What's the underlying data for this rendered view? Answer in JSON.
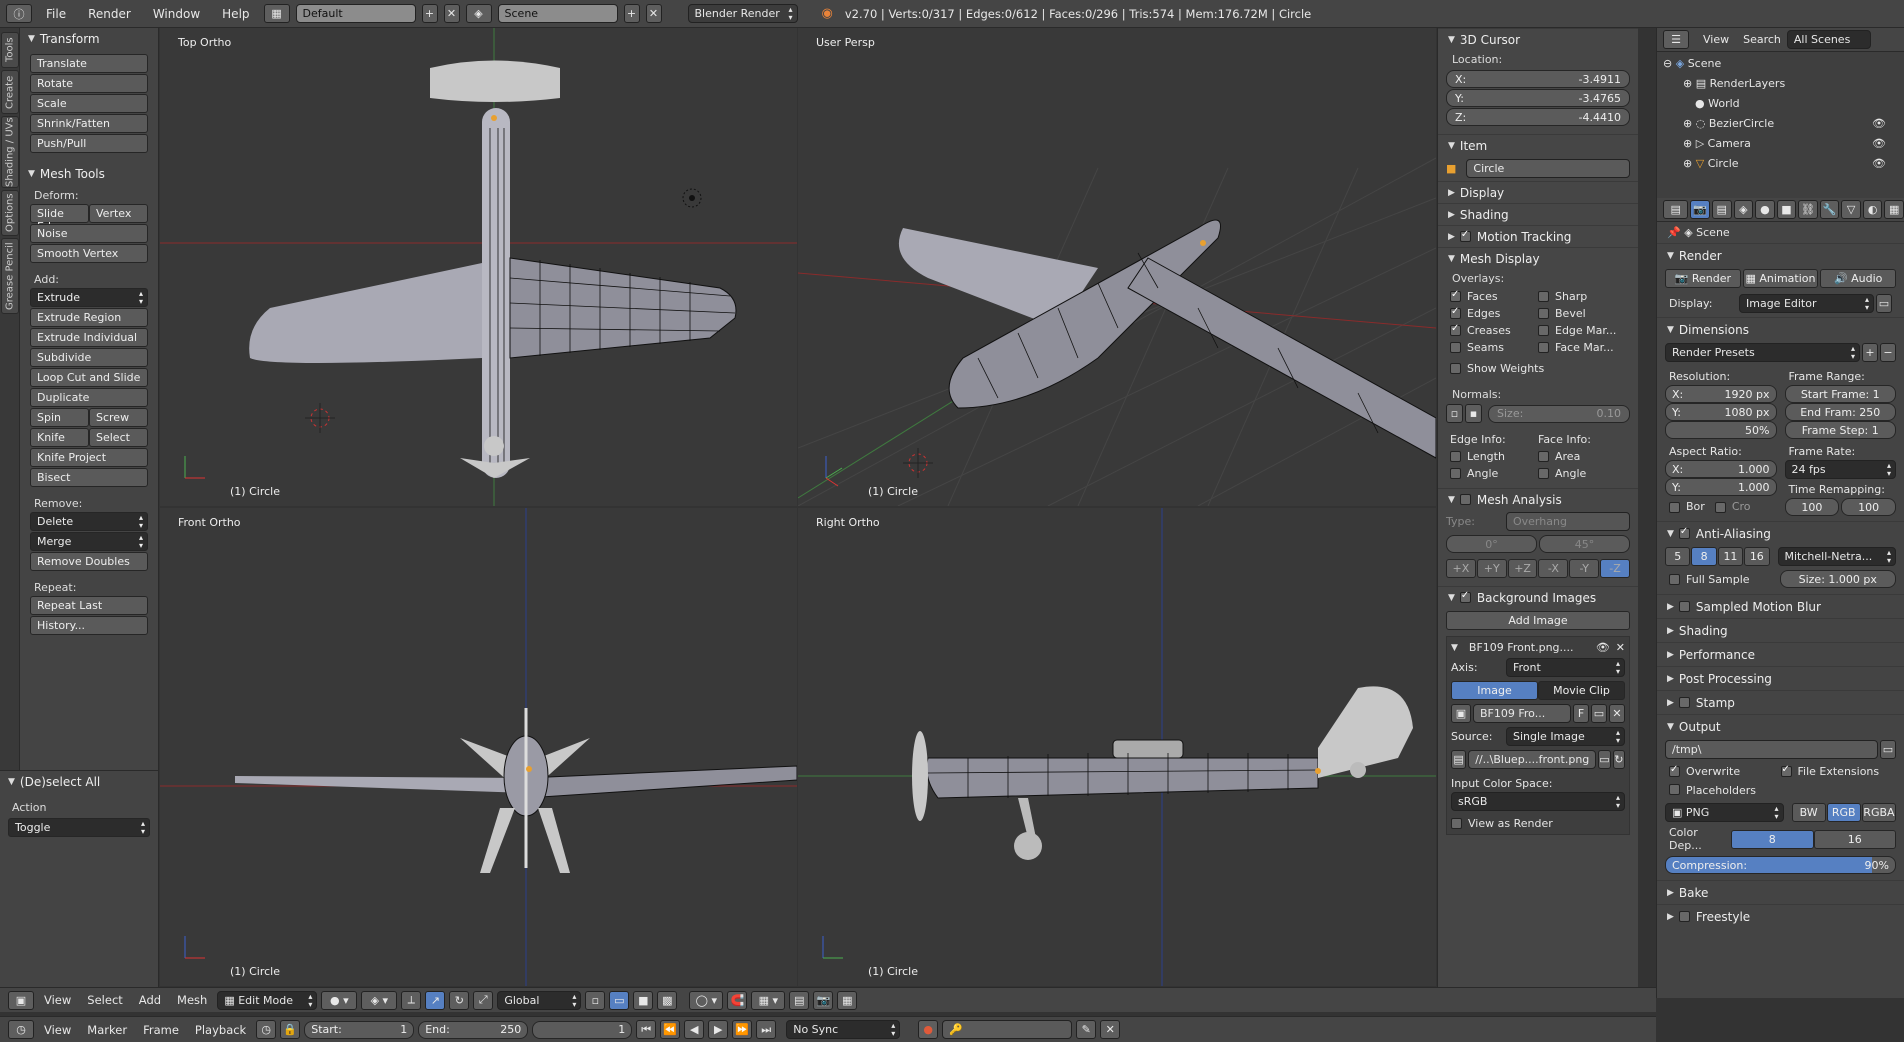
{
  "topbar": {
    "menus": [
      "File",
      "Render",
      "Window",
      "Help"
    ],
    "layout": "Default",
    "scene": "Scene",
    "engine": "Blender Render",
    "stats": "v2.70 | Verts:0/317 | Edges:0/612 | Faces:0/296 | Tris:574 | Mem:176.72M | Circle"
  },
  "vtabs": [
    "Tools",
    "Create",
    "Shading / UVs",
    "Options",
    "Grease Pencil"
  ],
  "tools": {
    "transform_title": "Transform",
    "transform": [
      "Translate",
      "Rotate",
      "Scale",
      "Shrink/Fatten",
      "Push/Pull"
    ],
    "mesh_tools_title": "Mesh Tools",
    "deform_label": "Deform:",
    "slide_edge": "Slide Edg",
    "vertex": "Vertex",
    "noise": "Noise",
    "smooth_vertex": "Smooth Vertex",
    "add_label": "Add:",
    "extrude": "Extrude",
    "add_items": [
      "Extrude Region",
      "Extrude Individual",
      "Subdivide",
      "Loop Cut and Slide",
      "Duplicate"
    ],
    "spin": "Spin",
    "screw": "Screw",
    "knife": "Knife",
    "select": "Select",
    "knife_project": "Knife Project",
    "bisect": "Bisect",
    "remove_label": "Remove:",
    "delete": "Delete",
    "merge": "Merge",
    "remove_doubles": "Remove Doubles",
    "repeat_label": "Repeat:",
    "repeat_last": "Repeat Last",
    "history": "History...",
    "operator_title": "(De)select All",
    "action_label": "Action",
    "action_value": "Toggle"
  },
  "viewports": {
    "top": {
      "title": "Top Ortho",
      "obj": "(1) Circle"
    },
    "persp": {
      "title": "User Persp",
      "obj": "(1) Circle"
    },
    "front": {
      "title": "Front Ortho",
      "obj": "(1) Circle"
    },
    "right": {
      "title": "Right Ortho",
      "obj": "(1) Circle"
    }
  },
  "npanel": {
    "cursor_title": "3D Cursor",
    "location_label": "Location:",
    "x_label": "X:",
    "x": "-3.4911",
    "y_label": "Y:",
    "y": "-3.4765",
    "z_label": "Z:",
    "z": "-4.4410",
    "item_title": "Item",
    "item_name": "Circle",
    "display": "Display",
    "shading": "Shading",
    "motion_tracking": "Motion Tracking",
    "mesh_display": "Mesh Display",
    "overlays_label": "Overlays:",
    "faces": "Faces",
    "sharp": "Sharp",
    "edges": "Edges",
    "bevel": "Bevel",
    "creases": "Creases",
    "edge_marks": "Edge Mar...",
    "seams": "Seams",
    "face_marks": "Face Mar...",
    "show_weights": "Show Weights",
    "normals_label": "Normals:",
    "size": "Size:",
    "size_val": "0.10",
    "edge_info": "Edge Info:",
    "face_info": "Face Info:",
    "length": "Length",
    "area": "Area",
    "angle": "Angle",
    "angle2": "Angle",
    "mesh_analysis": "Mesh Analysis",
    "type_label": "Type:",
    "type_val": "Overhang",
    "deg0": "0°",
    "deg45": "45°",
    "axes": [
      "+X",
      "+Y",
      "+Z",
      "-X",
      "-Y",
      "-Z"
    ],
    "bg_images": "Background Images",
    "add_image": "Add Image",
    "bg_file": "BF109 Front.png....",
    "axis_label": "Axis:",
    "axis_val": "Front",
    "image_tab": "Image",
    "movie_tab": "Movie Clip",
    "img_name": "BF109 Fro...",
    "img_f": "F",
    "source_label": "Source:",
    "source_val": "Single Image",
    "path": "//..\\Bluep....front.png",
    "color_space_label": "Input Color Space:",
    "color_space": "sRGB",
    "view_as_render": "View as Render"
  },
  "outliner": {
    "menus": [
      "View",
      "Search"
    ],
    "filter": "All Scenes",
    "items": [
      "Scene",
      "RenderLayers",
      "World",
      "BezierCircle",
      "Camera",
      "Circle"
    ]
  },
  "props": {
    "scene_crumb": "Scene",
    "render_title": "Render",
    "render_btn": "Render",
    "animation_btn": "Animation",
    "audio_btn": "Audio",
    "display_label": "Display:",
    "display_val": "Image Editor",
    "dimensions_title": "Dimensions",
    "presets": "Render Presets",
    "resolution_label": "Resolution:",
    "frame_range_label": "Frame Range:",
    "res_x_label": "X:",
    "res_x": "1920 px",
    "res_y_label": "Y:",
    "res_y": "1080 px",
    "res_pct": "50%",
    "start_frame": "Start Frame: 1",
    "end_frame": "End Fram: 250",
    "frame_step": "Frame Step: 1",
    "aspect_label": "Aspect Ratio:",
    "frame_rate_label": "Frame Rate:",
    "asp_x_label": "X:",
    "asp_x": "1.000",
    "asp_y_label": "Y:",
    "asp_y": "1.000",
    "fps": "24 fps",
    "time_remap_label": "Time Remapping:",
    "bor": "Bor",
    "cro": "Cro",
    "remap_old": "100",
    "remap_new": "100",
    "aa_title": "Anti-Aliasing",
    "aa_levels": [
      "5",
      "8",
      "11",
      "16"
    ],
    "aa_filter": "Mitchell-Netra...",
    "full_sample": "Full Sample",
    "aa_size": "Size: 1.000 px",
    "sampled_motion_blur": "Sampled Motion Blur",
    "shading": "Shading",
    "performance": "Performance",
    "post_processing": "Post Processing",
    "stamp": "Stamp",
    "output_title": "Output",
    "output_path": "/tmp\\",
    "overwrite": "Overwrite",
    "file_ext": "File Extensions",
    "placeholders": "Placeholders",
    "format": "PNG",
    "bw": "BW",
    "rgb": "RGB",
    "rgba": "RGBA",
    "color_depth_label": "Color Dep...",
    "depth8": "8",
    "depth16": "16",
    "compression": "Compression:",
    "compression_val": "90%",
    "bake": "Bake",
    "freestyle": "Freestyle"
  },
  "view3d_header": {
    "menus": [
      "View",
      "Select",
      "Add",
      "Mesh"
    ],
    "mode": "Edit Mode",
    "orientation": "Global"
  },
  "timeline": {
    "menus": [
      "View",
      "Marker",
      "Frame",
      "Playback"
    ],
    "start": "Start:",
    "start_val": "1",
    "end": "End:",
    "end_val": "250",
    "current": "1",
    "sync": "No Sync"
  },
  "colors": {
    "accent": "#5680c2",
    "grid_red": "#8a2b2b",
    "grid_green": "#3f7a3f",
    "grid_blue": "#2b3f8a"
  }
}
